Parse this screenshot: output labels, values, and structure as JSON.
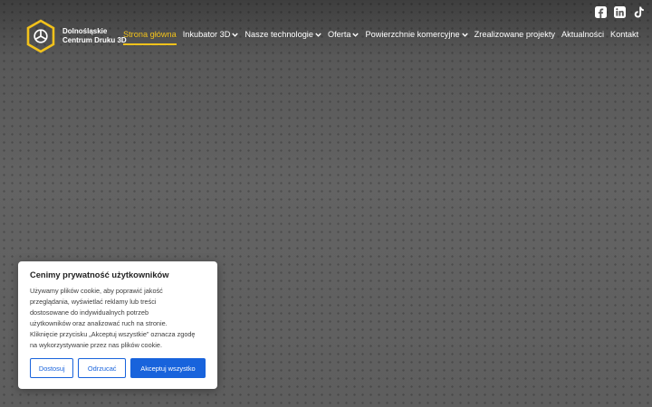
{
  "header": {
    "logo": {
      "line1": "Dolnośląskie",
      "line2": "Centrum Druku 3D",
      "icon": "cube-logo-icon"
    },
    "social": [
      {
        "icon": "facebook-icon"
      },
      {
        "icon": "linkedin-icon"
      },
      {
        "icon": "tiktok-icon"
      }
    ],
    "nav": [
      {
        "label": "Strona główna",
        "active": true,
        "dropdown": false
      },
      {
        "label": "Inkubator 3D",
        "active": false,
        "dropdown": true
      },
      {
        "label": "Nasze technologie",
        "active": false,
        "dropdown": true
      },
      {
        "label": "Oferta",
        "active": false,
        "dropdown": true
      },
      {
        "label": "Powierzchnie komercyjne",
        "active": false,
        "dropdown": true
      },
      {
        "label": "Zrealizowane projekty",
        "active": false,
        "dropdown": false
      },
      {
        "label": "Aktualności",
        "active": false,
        "dropdown": false
      },
      {
        "label": "Kontakt",
        "active": false,
        "dropdown": false
      }
    ]
  },
  "cookie": {
    "title": "Cenimy prywatność użytkowników",
    "text_lines": [
      "Używamy plików cookie, aby poprawić jakość",
      "przeglądania, wyświetlać reklamy lub treści",
      "dostosowane do indywidualnych potrzeb",
      "użytkowników oraz analizować ruch na stronie.",
      "Kliknięcie przycisku „Akceptuj wszystkie” oznacza zgodę",
      "na wykorzystywanie przez nas plików cookie."
    ],
    "buttons": {
      "customize": "Dostosuj",
      "reject": "Odrzucać",
      "accept": "Akceptuj wszystko"
    }
  },
  "colors": {
    "accent": "#f2c21b",
    "primary_button": "#1863dc",
    "background": "#5f5f5f"
  }
}
